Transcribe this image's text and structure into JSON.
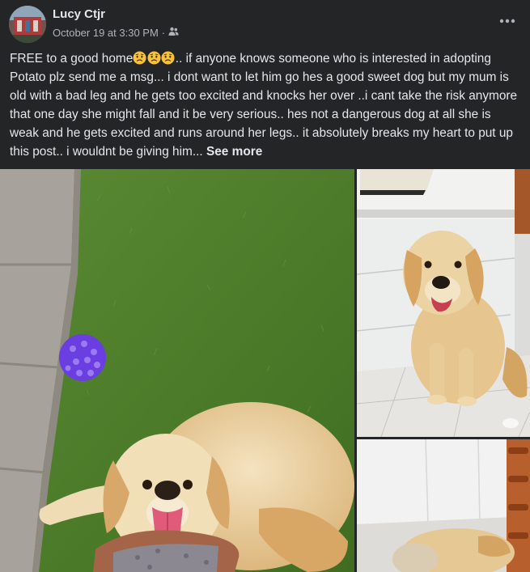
{
  "post": {
    "author": "Lucy Ctjr",
    "timestamp": "October 19 at 3:30 PM",
    "separator": "·",
    "audience_icon": "friends-icon",
    "more_icon": "more-options-icon",
    "text_lead": "FREE to a good home",
    "emojis": [
      "sad-face-emoji",
      "sad-face-emoji",
      "sad-face-emoji"
    ],
    "text_body": ".. if anyone knows someone who is interested in adopting Potato plz send me a msg... i dont want to let him go hes a good sweet dog but my mum is old with a bad leg and he gets too excited and knocks her over ..i cant take the risk anymore that one day she might fall and it be very serious.. hes not a dangerous dog at all she is weak and he gets excited and runs around her legs.. it absolutely breaks my heart to put up this post.. i wouldnt be giving him...",
    "see_more": "See more"
  },
  "photos": [
    {
      "subject": "golden retriever lying on grass with toys"
    },
    {
      "subject": "golden retriever sitting on tiled floor"
    },
    {
      "subject": "golden retriever sleeping on floor"
    }
  ],
  "colors": {
    "background": "#242526",
    "text_primary": "#e4e6eb",
    "text_secondary": "#b0b3b8",
    "grass": "#4f7a2c",
    "dog_fur": "#e8c993"
  }
}
